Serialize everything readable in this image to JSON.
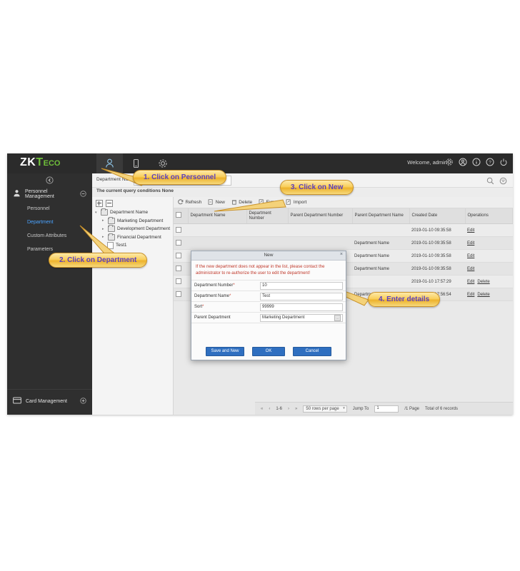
{
  "header": {
    "logo_z": "ZK",
    "logo_t": "T",
    "logo_eco": "ECO",
    "welcome": "Welcome, admin",
    "nav_icons": [
      "person-icon",
      "device-icon",
      "gear-icon"
    ],
    "right_icons": [
      "gear-icon",
      "user-icon",
      "info-icon",
      "help-icon",
      "power-icon"
    ]
  },
  "sidebar": {
    "collapse_label": "«",
    "group": {
      "label": "Personnel Management",
      "toggle": "−"
    },
    "items": [
      {
        "label": "Personnel",
        "active": false
      },
      {
        "label": "Department",
        "active": true
      },
      {
        "label": "Custom Attributes",
        "active": false
      },
      {
        "label": "Parameters",
        "active": false
      }
    ],
    "bottom_group": {
      "label": "Card Management",
      "toggle": "+"
    }
  },
  "search": {
    "label": "Department Name",
    "value": "",
    "query_conditions": "The current query conditions None"
  },
  "tree": {
    "expand_all": "expand-icon",
    "collapse_all": "collapse-icon",
    "nodes": [
      {
        "label": "Department Name",
        "level": 0,
        "type": "folder",
        "arrow": "▾"
      },
      {
        "label": "Marketing Department",
        "level": 1,
        "type": "folder",
        "arrow": "▸"
      },
      {
        "label": "Development Department",
        "level": 1,
        "type": "folder",
        "arrow": "▸"
      },
      {
        "label": "Financial Department",
        "level": 1,
        "type": "folder",
        "arrow": "▸"
      },
      {
        "label": "Test1",
        "level": 2,
        "type": "file",
        "arrow": ""
      }
    ]
  },
  "toolbar": {
    "refresh": "Refresh",
    "new": "New",
    "delete": "Delete",
    "export": "Export",
    "import": "Import"
  },
  "table": {
    "columns": [
      "Department Name",
      "Department Number",
      "Parent Department Number",
      "Parent Department Name",
      "Created Date",
      "Operations"
    ],
    "rows": [
      {
        "name": "",
        "number": "",
        "parent_number": "",
        "parent_name": "",
        "created": "2019-01-10 09:35:58",
        "ops": [
          "Edit"
        ]
      },
      {
        "name": "",
        "number": "",
        "parent_number": "",
        "parent_name": "Department Name",
        "created": "2019-01-10 09:35:58",
        "ops": [
          "Edit"
        ]
      },
      {
        "name": "",
        "number": "",
        "parent_number": "",
        "parent_name": "Department Name",
        "created": "2019-01-10 09:35:58",
        "ops": [
          "Edit"
        ]
      },
      {
        "name": "",
        "number": "",
        "parent_number": "",
        "parent_name": "Department Name",
        "created": "2019-01-10 09:35:58",
        "ops": [
          "Edit"
        ]
      },
      {
        "name": "",
        "number": "",
        "parent_number": "",
        "parent_name": "",
        "created": "2019-01-10 17:57:29",
        "ops": [
          "Edit",
          "Delete"
        ]
      },
      {
        "name": "",
        "number": "",
        "parent_number": "",
        "parent_name": "Department",
        "created": "2019-01-10 17:56:54",
        "ops": [
          "Edit",
          "Delete"
        ]
      }
    ]
  },
  "pager": {
    "first": "«",
    "prev": "‹",
    "range": "1-6",
    "next": "›",
    "last": "»",
    "rows_per_page": "50 rows per page",
    "jump_label": "Jump To",
    "jump_value": "1",
    "page_total": "/1 Page",
    "total": "Total of 6 records"
  },
  "modal": {
    "title": "New",
    "close": "×",
    "warning": "If the new department does not appear in the list, please contact the administrator to re-authorize the user to edit the department!",
    "fields": [
      {
        "label": "Department Number",
        "required": true,
        "value": "10",
        "type": "input"
      },
      {
        "label": "Department Name",
        "required": true,
        "value": "Test",
        "type": "input"
      },
      {
        "label": "Sort",
        "required": true,
        "value": "99999",
        "type": "input"
      },
      {
        "label": "Parent Department",
        "required": false,
        "value": "Marketing Department",
        "type": "select"
      }
    ],
    "buttons": {
      "save_and_new": "Save and New",
      "ok": "OK",
      "cancel": "Cancel"
    }
  },
  "callouts": [
    {
      "text": "1. Click on Personnel"
    },
    {
      "text": "2. Click on Department"
    },
    {
      "text": "3. Click on New"
    },
    {
      "text": "4. Enter details"
    }
  ],
  "colors": {
    "accent_green": "#6fbf3a",
    "link_blue": "#4aa3ff",
    "button_blue": "#2f6fc0",
    "warning_red": "#c0392b",
    "callout_bg": "#f9cf5c",
    "callout_text": "#5b3fbf"
  }
}
